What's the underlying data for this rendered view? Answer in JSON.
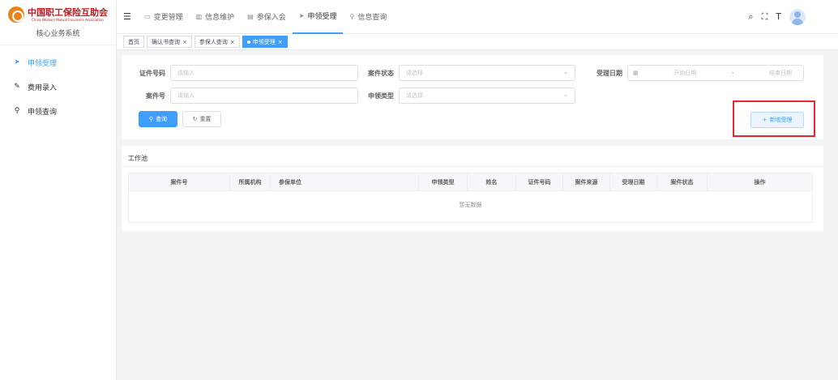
{
  "logo": {
    "name": "中国职工保险互助会",
    "subtitle": "China Workers Mutual Insurance Association",
    "system": "核心业务系统"
  },
  "sidebar": {
    "items": [
      {
        "label": "申领受理",
        "icon": "send-icon",
        "active": true
      },
      {
        "label": "费用录入",
        "icon": "edit-icon",
        "active": false
      },
      {
        "label": "申领查询",
        "icon": "search-icon",
        "active": false
      }
    ]
  },
  "header": {
    "nav": [
      {
        "label": "变更管理",
        "icon": "monitor-icon"
      },
      {
        "label": "信息维护",
        "icon": "chart-icon"
      },
      {
        "label": "参保入会",
        "icon": "document-icon"
      },
      {
        "label": "申领受理",
        "icon": "send-icon",
        "active": true
      },
      {
        "label": "信息查询",
        "icon": "search-icon"
      }
    ]
  },
  "tabs": [
    {
      "label": "首页",
      "closable": false
    },
    {
      "label": "确认书查询",
      "closable": true
    },
    {
      "label": "参保人查询",
      "closable": true
    },
    {
      "label": "申领受理",
      "closable": true,
      "active": true
    }
  ],
  "search": {
    "id_number": {
      "label": "证件号码",
      "placeholder": "请输入"
    },
    "case_status": {
      "label": "案件状态",
      "placeholder": "请选择"
    },
    "accept_date": {
      "label": "受理日期",
      "start_placeholder": "开始日期",
      "separator": "-",
      "end_placeholder": "结束日期"
    },
    "case_number": {
      "label": "案件号",
      "placeholder": "请输入"
    },
    "claim_type": {
      "label": "申领类型",
      "placeholder": "请选择"
    },
    "query_label": "查询",
    "reset_label": "重置",
    "new_label": "新增受理"
  },
  "worklist": {
    "title": "工作池",
    "columns": [
      "案件号",
      "所属机构",
      "参保单位",
      "申领类型",
      "姓名",
      "证件号码",
      "案件来源",
      "受理日期",
      "案件状态",
      "操作"
    ],
    "empty_text": "暂无数据"
  },
  "colors": {
    "primary": "#409eff",
    "highlight": "#e8262e",
    "logo_red": "#c8161d"
  }
}
